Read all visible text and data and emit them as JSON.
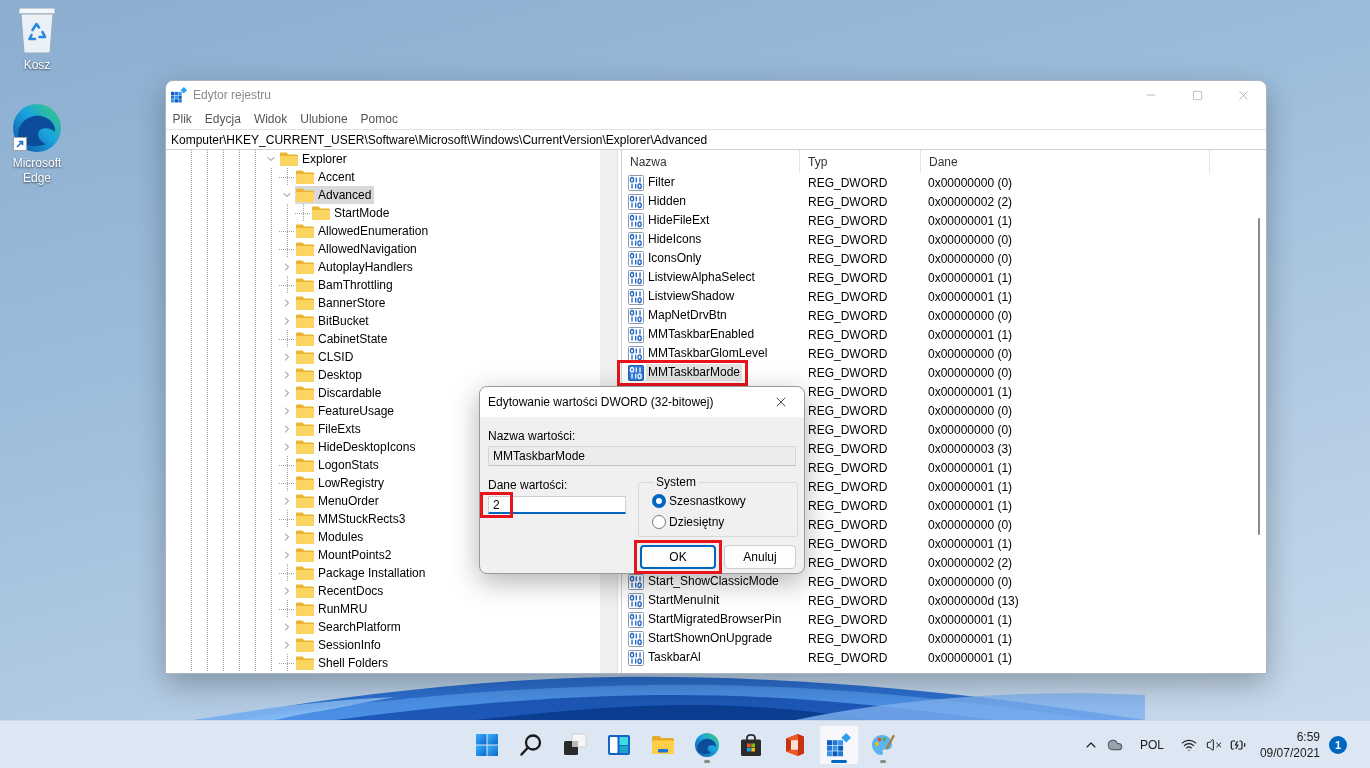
{
  "desktop_icons": [
    {
      "label": "Kosz",
      "kind": "bin",
      "shortcut": false
    },
    {
      "label": "Microsoft Edge",
      "kind": "browser",
      "shortcut": true
    }
  ],
  "window": {
    "title": "Edytor rejestru",
    "active": false,
    "menu": [
      "Plik",
      "Edycja",
      "Widok",
      "Ulubione",
      "Pomoc"
    ],
    "address": "Komputer\\HKEY_CURRENT_USER\\Software\\Microsoft\\Windows\\CurrentVersion\\Explorer\\Advanced",
    "tree": [
      {
        "label": "Explorer",
        "has_children": true,
        "expanded": true,
        "selected": false,
        "children": [
          {
            "label": "Accent",
            "has_children": false,
            "selected": false
          },
          {
            "label": "Advanced",
            "has_children": true,
            "expanded": true,
            "selected": true,
            "children": [
              {
                "label": "StartMode",
                "has_children": false,
                "selected": false
              }
            ]
          },
          {
            "label": "AllowedEnumeration",
            "has_children": false,
            "selected": false
          },
          {
            "label": "AllowedNavigation",
            "has_children": false,
            "selected": false
          },
          {
            "label": "AutoplayHandlers",
            "has_children": true,
            "expanded": false,
            "selected": false
          },
          {
            "label": "BamThrottling",
            "has_children": false,
            "selected": false
          },
          {
            "label": "BannerStore",
            "has_children": true,
            "expanded": false,
            "selected": false
          },
          {
            "label": "BitBucket",
            "has_children": true,
            "expanded": false,
            "selected": false
          },
          {
            "label": "CabinetState",
            "has_children": false,
            "selected": false
          },
          {
            "label": "CLSID",
            "has_children": true,
            "expanded": false,
            "selected": false
          },
          {
            "label": "Desktop",
            "has_children": true,
            "expanded": false,
            "selected": false
          },
          {
            "label": "Discardable",
            "has_children": true,
            "expanded": false,
            "selected": false
          },
          {
            "label": "FeatureUsage",
            "has_children": true,
            "expanded": false,
            "selected": false
          },
          {
            "label": "FileExts",
            "has_children": true,
            "expanded": false,
            "selected": false
          },
          {
            "label": "HideDesktopIcons",
            "has_children": true,
            "expanded": false,
            "selected": false
          },
          {
            "label": "LogonStats",
            "has_children": false,
            "selected": false
          },
          {
            "label": "LowRegistry",
            "has_children": false,
            "selected": false
          },
          {
            "label": "MenuOrder",
            "has_children": true,
            "expanded": false,
            "selected": false
          },
          {
            "label": "MMStuckRects3",
            "has_children": false,
            "selected": false
          },
          {
            "label": "Modules",
            "has_children": true,
            "expanded": false,
            "selected": false
          },
          {
            "label": "MountPoints2",
            "has_children": true,
            "expanded": false,
            "selected": false
          },
          {
            "label": "Package Installation",
            "has_children": false,
            "selected": false
          },
          {
            "label": "RecentDocs",
            "has_children": true,
            "expanded": false,
            "selected": false
          },
          {
            "label": "RunMRU",
            "has_children": false,
            "selected": false
          },
          {
            "label": "SearchPlatform",
            "has_children": true,
            "expanded": false,
            "selected": false
          },
          {
            "label": "SessionInfo",
            "has_children": true,
            "expanded": false,
            "selected": false
          },
          {
            "label": "Shell Folders",
            "has_children": false,
            "selected": false
          }
        ]
      }
    ],
    "values": {
      "columns": [
        "Nazwa",
        "Typ",
        "Dane"
      ],
      "rows": [
        {
          "name": "Filter",
          "type": "REG_DWORD",
          "data": "0x00000000 (0)",
          "selected": false,
          "highlighted": false
        },
        {
          "name": "Hidden",
          "type": "REG_DWORD",
          "data": "0x00000002 (2)",
          "selected": false,
          "highlighted": false
        },
        {
          "name": "HideFileExt",
          "type": "REG_DWORD",
          "data": "0x00000001 (1)",
          "selected": false,
          "highlighted": false
        },
        {
          "name": "HideIcons",
          "type": "REG_DWORD",
          "data": "0x00000000 (0)",
          "selected": false,
          "highlighted": false
        },
        {
          "name": "IconsOnly",
          "type": "REG_DWORD",
          "data": "0x00000000 (0)",
          "selected": false,
          "highlighted": false
        },
        {
          "name": "ListviewAlphaSelect",
          "type": "REG_DWORD",
          "data": "0x00000001 (1)",
          "selected": false,
          "highlighted": false
        },
        {
          "name": "ListviewShadow",
          "type": "REG_DWORD",
          "data": "0x00000001 (1)",
          "selected": false,
          "highlighted": false
        },
        {
          "name": "MapNetDrvBtn",
          "type": "REG_DWORD",
          "data": "0x00000000 (0)",
          "selected": false,
          "highlighted": false
        },
        {
          "name": "MMTaskbarEnabled",
          "type": "REG_DWORD",
          "data": "0x00000001 (1)",
          "selected": false,
          "highlighted": false
        },
        {
          "name": "MMTaskbarGlomLevel",
          "type": "REG_DWORD",
          "data": "0x00000000 (0)",
          "selected": false,
          "highlighted": false
        },
        {
          "name": "MMTaskbarMode",
          "type": "REG_DWORD",
          "data": "0x00000000 (0)",
          "selected": true,
          "highlighted": true
        },
        {
          "type": "REG_DWORD",
          "data": "0x00000001 (1)"
        },
        {
          "type": "REG_DWORD",
          "data": "0x00000000 (0)"
        },
        {
          "type": "REG_DWORD",
          "data": "0x00000000 (0)"
        },
        {
          "type": "REG_DWORD",
          "data": "0x00000003 (3)"
        },
        {
          "type": "REG_DWORD",
          "data": "0x00000001 (1)"
        },
        {
          "type": "REG_DWORD",
          "data": "0x00000001 (1)"
        },
        {
          "type": "REG_DWORD",
          "data": "0x00000001 (1)"
        },
        {
          "type": "REG_DWORD",
          "data": "0x00000000 (0)"
        },
        {
          "type": "REG_DWORD",
          "data": "0x00000001 (1)"
        },
        {
          "type": "REG_DWORD",
          "data": "0x00000002 (2)"
        },
        {
          "name": "Start_ShowClassicMode",
          "type": "REG_DWORD",
          "data": "0x00000000 (0)",
          "selected": false,
          "highlighted": false
        },
        {
          "name": "StartMenuInit",
          "type": "REG_DWORD",
          "data": "0x0000000d (13)",
          "selected": false,
          "highlighted": false
        },
        {
          "name": "StartMigratedBrowserPin",
          "type": "REG_DWORD",
          "data": "0x00000001 (1)",
          "selected": false,
          "highlighted": false
        },
        {
          "name": "StartShownOnUpgrade",
          "type": "REG_DWORD",
          "data": "0x00000001 (1)",
          "selected": false,
          "highlighted": false
        },
        {
          "name": "TaskbarAl",
          "type": "REG_DWORD",
          "data": "0x00000001 (1)",
          "selected": false,
          "highlighted": false
        }
      ]
    }
  },
  "dialog": {
    "title": "Edytowanie wartości DWORD (32-bitowej)",
    "name_label": "Nazwa wartości:",
    "name_value": "MMTaskbarMode",
    "data_label": "Dane wartości:",
    "data_value": "2",
    "data_focused": true,
    "data_highlighted": true,
    "base_label": "System",
    "base_options": [
      {
        "label": "Szesnastkowy",
        "selected": true
      },
      {
        "label": "Dziesiętny",
        "selected": false
      }
    ],
    "buttons": [
      {
        "label": "OK",
        "default": true,
        "highlighted": true
      },
      {
        "label": "Anuluj",
        "default": false
      }
    ]
  },
  "taskbar": {
    "apps": [
      {
        "kind": "start",
        "running": false,
        "active": false
      },
      {
        "kind": "search",
        "running": false,
        "active": false
      },
      {
        "kind": "taskview",
        "running": false,
        "active": false
      },
      {
        "kind": "widgets",
        "running": false,
        "active": false
      },
      {
        "kind": "explorer",
        "running": false,
        "active": false
      },
      {
        "kind": "browser",
        "running": true,
        "active": false
      },
      {
        "kind": "store",
        "running": false,
        "active": false
      },
      {
        "kind": "office",
        "running": false,
        "active": false
      },
      {
        "kind": "registry",
        "running": true,
        "active": true
      },
      {
        "kind": "paint",
        "running": true,
        "active": false
      }
    ],
    "tray": {
      "language": "POL",
      "muted": true,
      "charging": true,
      "time": "6:59",
      "date": "09/07/2021",
      "notifications": "1"
    }
  }
}
